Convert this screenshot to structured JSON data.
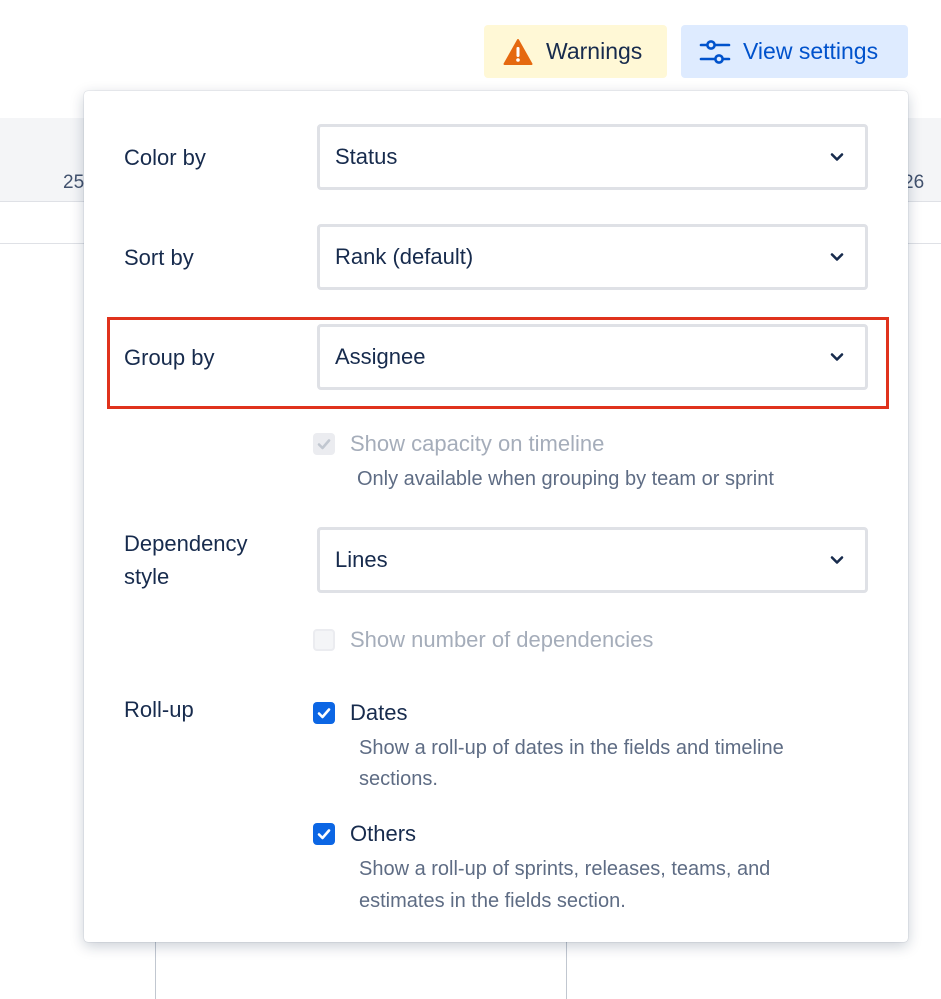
{
  "background": {
    "tick_left": "25",
    "tick_right": "26"
  },
  "toolbar": {
    "warnings_label": "Warnings",
    "view_settings_label": "View settings"
  },
  "settings": {
    "color_by": {
      "label": "Color by",
      "value": "Status"
    },
    "sort_by": {
      "label": "Sort by",
      "value": "Rank (default)"
    },
    "group_by": {
      "label": "Group by",
      "value": "Assignee"
    },
    "show_capacity": {
      "label": "Show capacity on timeline",
      "helper": "Only available when grouping by team or sprint",
      "checked": true,
      "disabled": true
    },
    "dependency_style": {
      "label_line1": "Dependency",
      "label_line2": "style",
      "value": "Lines"
    },
    "show_dependencies": {
      "label": "Show number of dependencies",
      "checked": false,
      "disabled": true
    },
    "rollup": {
      "label": "Roll-up",
      "dates": {
        "label": "Dates",
        "helper_line1": "Show a roll-up of dates in the fields and timeline",
        "helper_line2": "sections.",
        "checked": true
      },
      "others": {
        "label": "Others",
        "helper_line1": "Show a roll-up of sprints, releases, teams, and",
        "helper_line2": "estimates in the fields section.",
        "checked": true
      }
    }
  },
  "colors": {
    "accent": "#0c66e4",
    "warning_bg": "#fff8d6",
    "warning_icon": "#e56910",
    "view_bg": "#deebff",
    "highlight": "#e0321c"
  }
}
